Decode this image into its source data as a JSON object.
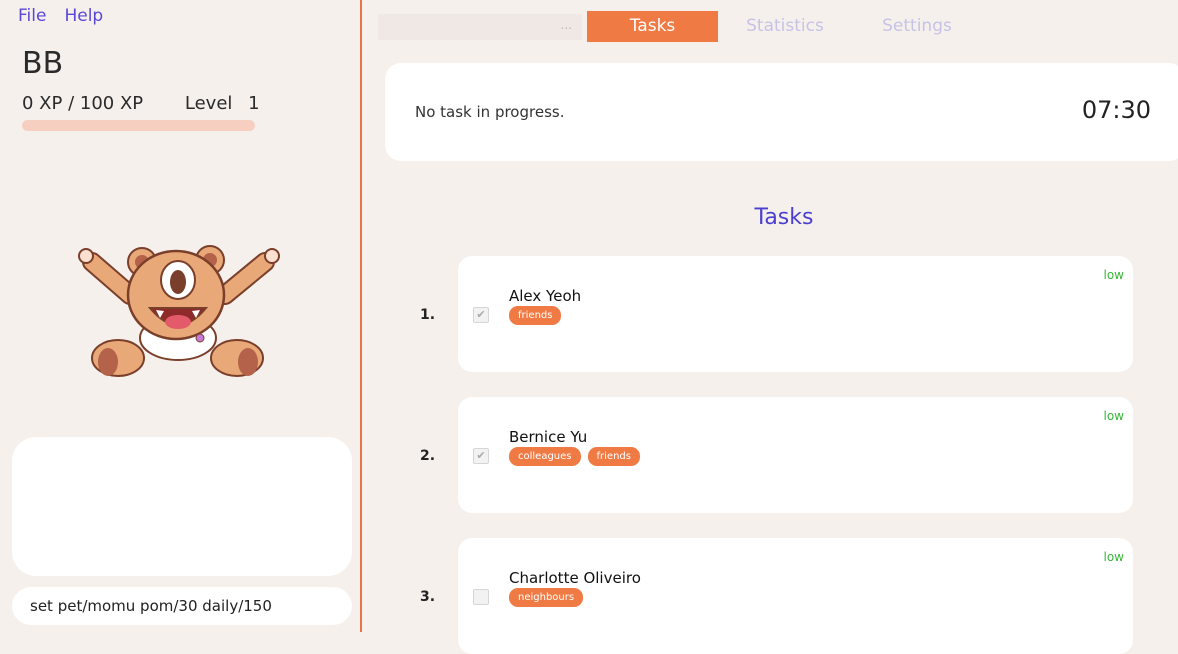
{
  "menu": {
    "file": "File",
    "help": "Help"
  },
  "pet": {
    "name": "BB",
    "xp_text": "0 XP / 100 XP",
    "level_label": "Level",
    "level_value": "1",
    "xp_progress": 0
  },
  "command": {
    "value": "set pet/momu pom/30 daily/150"
  },
  "tabs": {
    "overflow": "...",
    "tasks": "Tasks",
    "statistics": "Statistics",
    "settings": "Settings"
  },
  "timer": {
    "status": "No task in progress.",
    "time": "07:30"
  },
  "task_list": {
    "title": "Tasks",
    "tasks": [
      {
        "index": "1.",
        "name": "Alex Yeoh",
        "tags": [
          "friends"
        ],
        "priority": "low",
        "done": true
      },
      {
        "index": "2.",
        "name": "Bernice Yu",
        "tags": [
          "colleagues",
          "friends"
        ],
        "priority": "low",
        "done": true
      },
      {
        "index": "3.",
        "name": "Charlotte Oliveiro",
        "tags": [
          "neighbours"
        ],
        "priority": "low",
        "done": false
      }
    ]
  },
  "colors": {
    "accent": "#f07a44",
    "menu": "#5a48d6",
    "title": "#4a3fd0",
    "priority_low": "#3ab53a"
  },
  "icons": {
    "pet": "one-eyed-bear-pet",
    "check": "checkbox"
  }
}
